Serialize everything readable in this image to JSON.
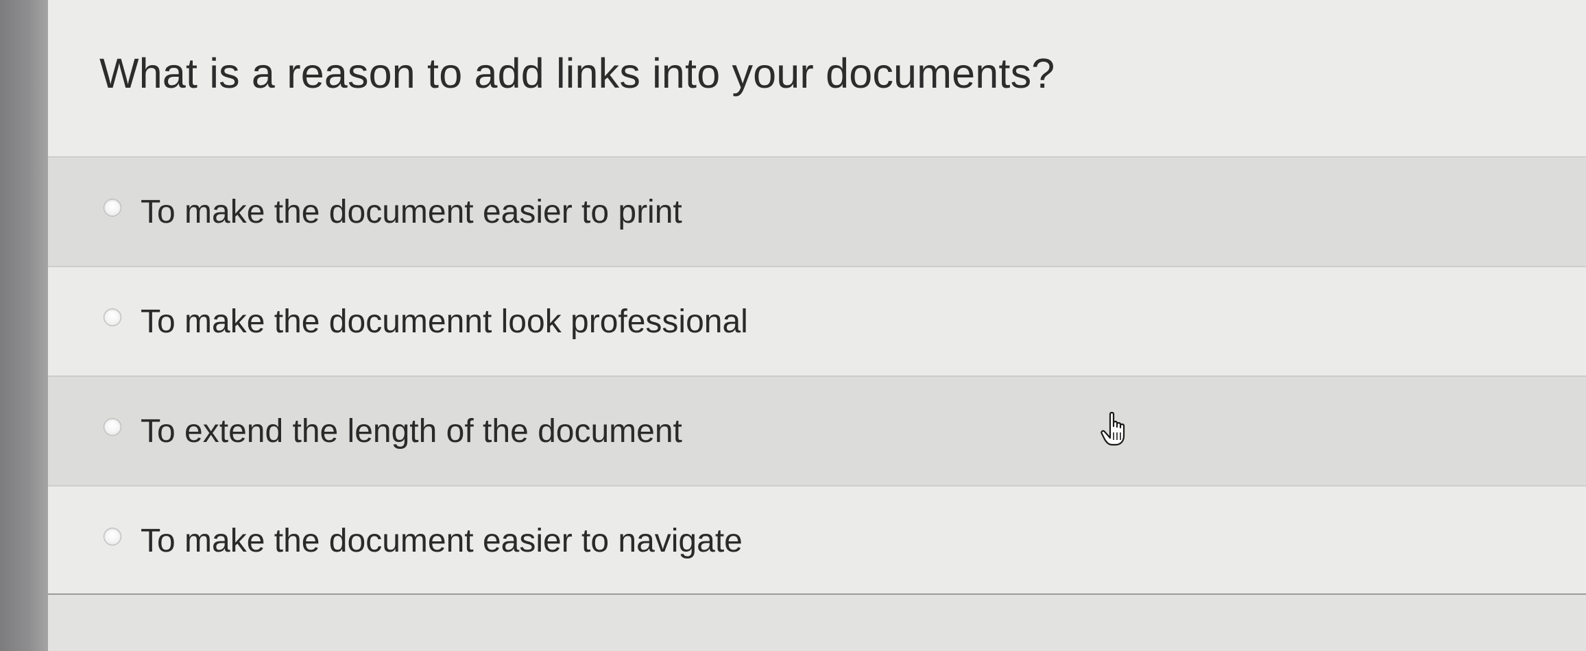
{
  "question": {
    "text": "What is a reason to add links into your documents?"
  },
  "options": [
    {
      "label": "To make the document easier to print",
      "selected": false
    },
    {
      "label": "To make the documennt look professional",
      "selected": false
    },
    {
      "label": "To extend the length of the document",
      "selected": false
    },
    {
      "label": "To make the document easier to navigate",
      "selected": false
    }
  ],
  "cursor": {
    "icon": "hand-pointer-icon"
  },
  "colors": {
    "text": "#2a2a2a",
    "row_shaded": "#dcdcda",
    "row_light": "#ebebe9",
    "left_bar": "#8e8e90"
  }
}
